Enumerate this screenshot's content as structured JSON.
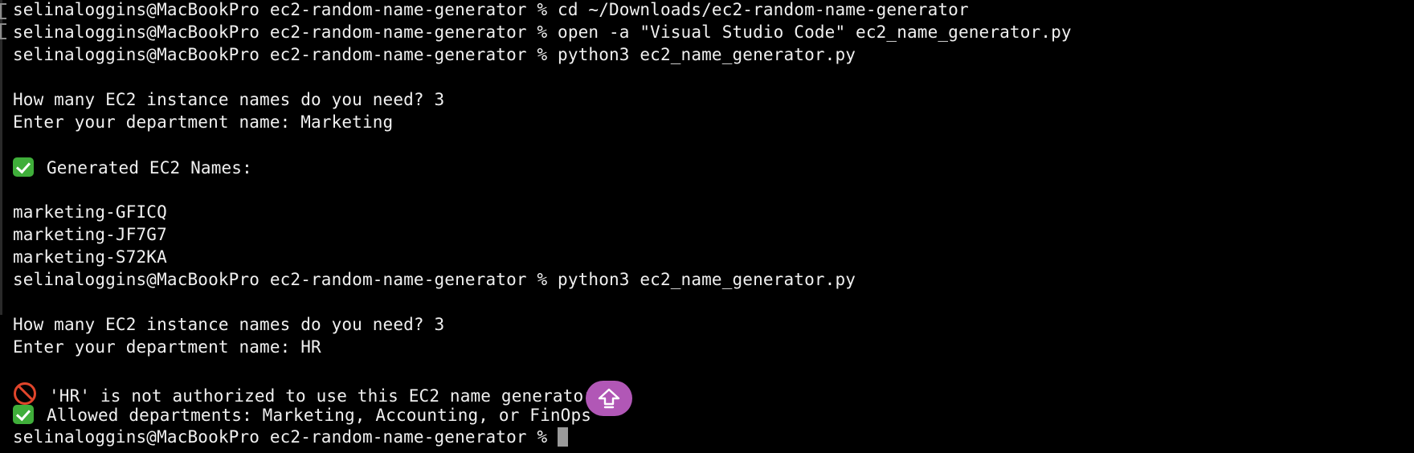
{
  "terminal": {
    "lines": [
      "selinaloggins@MacBookPro ec2-random-name-generator % cd ~/Downloads/ec2-random-name-generator",
      "selinaloggins@MacBookPro ec2-random-name-generator % open -a \"Visual Studio Code\" ec2_name_generator.py",
      "selinaloggins@MacBookPro ec2-random-name-generator % python3 ec2_name_generator.py",
      "",
      "How many EC2 instance names do you need? 3",
      "Enter your department name: Marketing",
      "",
      "Generated EC2 Names:",
      "",
      "marketing-GFICQ",
      "marketing-JF7G7",
      "marketing-S72KA",
      "selinaloggins@MacBookPro ec2-random-name-generator % python3 ec2_name_generator.py",
      "",
      "How many EC2 instance names do you need? 3",
      "Enter your department name: HR",
      "",
      "'HR' is not authorized to use this EC2 name generator.",
      "Allowed departments: Marketing, Accounting, or FinOps",
      "selinaloggins@MacBookPro ec2-random-name-generator % "
    ],
    "icons": {
      "check": "check-mark-emoji",
      "prohibited": "prohibited-emoji",
      "floating": "upload-arrow-icon"
    },
    "colors": {
      "background": "#000000",
      "text": "#f0f0f0",
      "check": "#3fae3a",
      "prohibited": "#e0452b",
      "fab": "#b157b6",
      "cursor": "#9a9a9a"
    }
  }
}
